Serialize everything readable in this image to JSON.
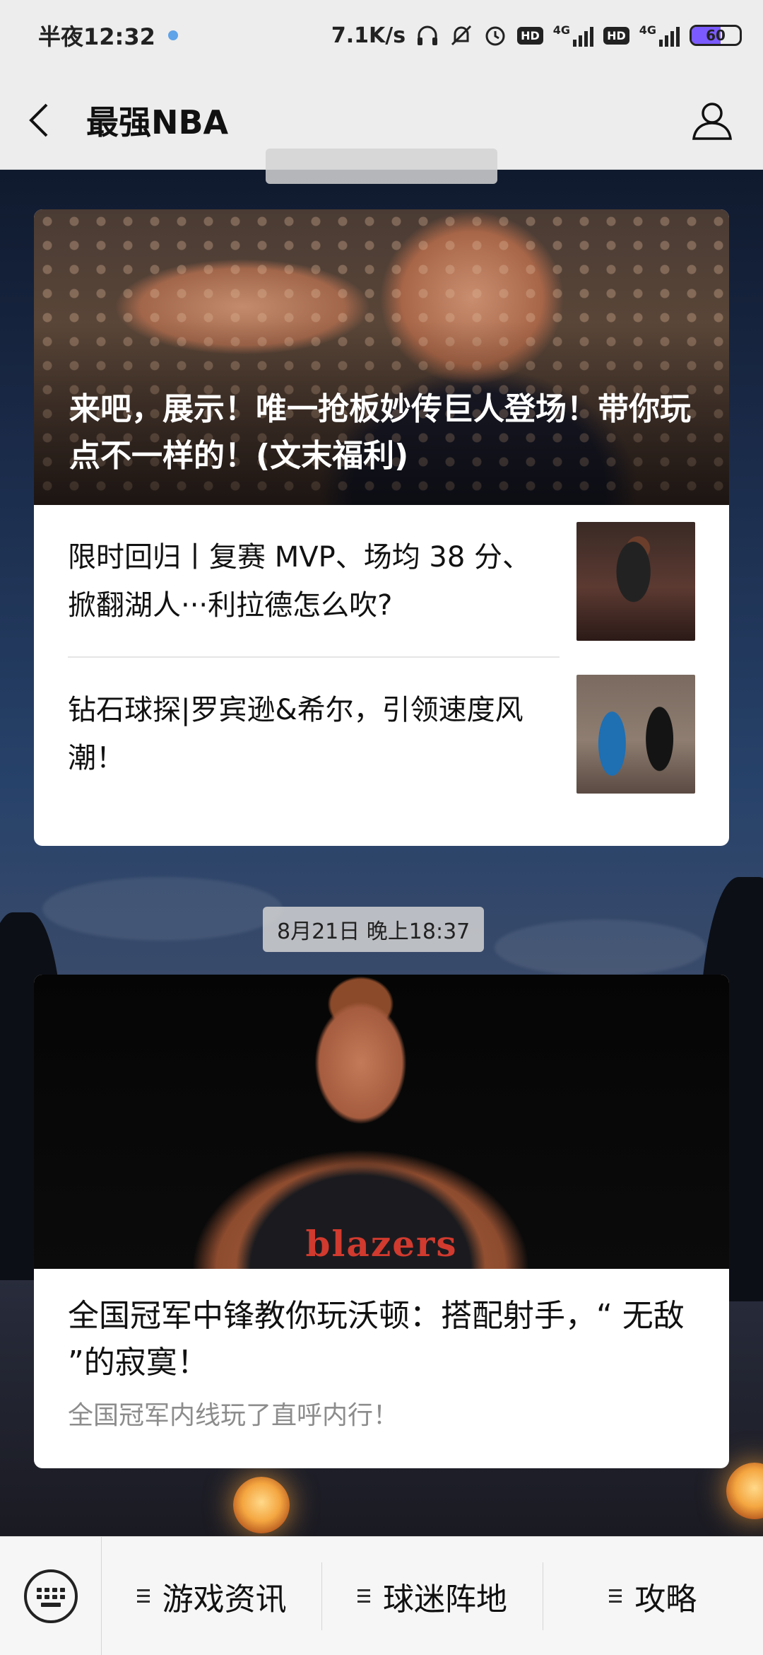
{
  "status_bar": {
    "time": "半夜12:32",
    "network_speed": "7.1K/s",
    "hd_label": "HD",
    "net_type": "4G",
    "battery": "60",
    "battery_level": 0.6
  },
  "nav": {
    "title": "最强NBA"
  },
  "messages": [
    {
      "timestamp": "",
      "headline": "来吧，展示！唯一抢板妙传巨人登场！带你玩点不一样的！(文末福利)",
      "sub_articles": [
        {
          "title": "限时回归丨复赛 MVP、场均 38 分、掀翻湖人···利拉德怎么吹?"
        },
        {
          "title": "钻石球探|罗宾逊&希尔，引领速度风潮！"
        }
      ]
    },
    {
      "timestamp": "8月21日 晚上18:37",
      "hero_text": "blazers",
      "headline": "全国冠军中锋教你玩沃顿：搭配射手，“ 无敌 ”的寂寞！",
      "description": "全国冠军内线玩了直呼内行！"
    }
  ],
  "bottom_menu": {
    "items": [
      {
        "label": "游戏资讯"
      },
      {
        "label": "球迷阵地"
      },
      {
        "label": "攻略"
      }
    ]
  }
}
